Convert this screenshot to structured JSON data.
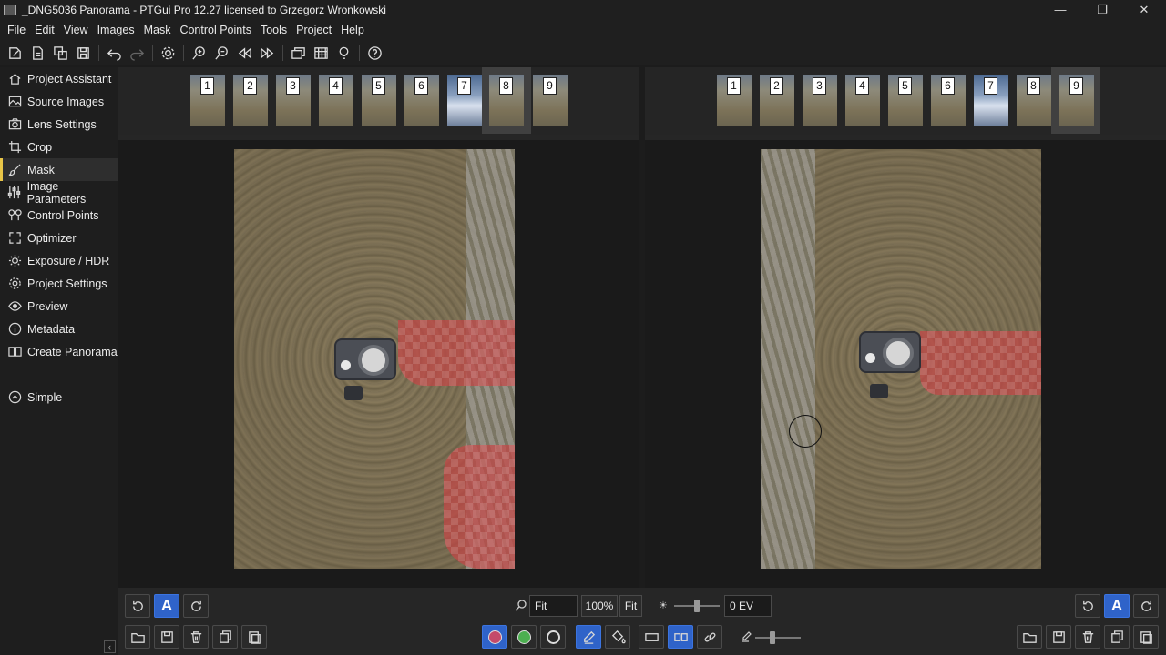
{
  "window": {
    "title": "_DNG5036 Panorama - PTGui Pro 12.27 licensed to Grzegorz Wronkowski",
    "minimize_glyph": "—",
    "maximize_glyph": "❐",
    "close_glyph": "✕"
  },
  "menu": [
    "File",
    "Edit",
    "View",
    "Images",
    "Mask",
    "Control Points",
    "Tools",
    "Project",
    "Help"
  ],
  "toolbar": {
    "icons": [
      "new-project-icon",
      "open-project-icon",
      "copy-icon",
      "save-icon",
      "undo-icon",
      "redo-icon",
      "settings-icon",
      "zoom-in-icon",
      "zoom-out-icon",
      "previous-icon",
      "next-icon",
      "panorama-editor-icon",
      "table-icon",
      "lightbulb-icon",
      "help-icon"
    ]
  },
  "sidebar": {
    "items": [
      {
        "label": "Project Assistant",
        "icon": "home-icon"
      },
      {
        "label": "Source Images",
        "icon": "image-icon"
      },
      {
        "label": "Lens Settings",
        "icon": "camera-icon"
      },
      {
        "label": "Crop",
        "icon": "crop-icon"
      },
      {
        "label": "Mask",
        "icon": "brush-icon",
        "active": true
      },
      {
        "label": "Image Parameters",
        "icon": "sliders-icon"
      },
      {
        "label": "Control Points",
        "icon": "control-points-icon"
      },
      {
        "label": "Optimizer",
        "icon": "optimizer-icon"
      },
      {
        "label": "Exposure / HDR",
        "icon": "sun-icon"
      },
      {
        "label": "Project Settings",
        "icon": "gear-icon"
      },
      {
        "label": "Preview",
        "icon": "eye-icon"
      },
      {
        "label": "Metadata",
        "icon": "info-icon"
      },
      {
        "label": "Create Panorama",
        "icon": "book-icon"
      }
    ],
    "simple_label": "Simple",
    "collapse_glyph": "‹"
  },
  "left_pane": {
    "thumbs": [
      "1",
      "2",
      "3",
      "4",
      "5",
      "6",
      "7",
      "8",
      "9"
    ],
    "selected": "8"
  },
  "right_pane": {
    "thumbs": [
      "1",
      "2",
      "3",
      "4",
      "5",
      "6",
      "7",
      "8",
      "9"
    ],
    "selected": "9"
  },
  "bottom": {
    "zoom_value": "Fit",
    "zoom_100": "100%",
    "zoom_fit": "Fit",
    "exposure_value": "0 EV",
    "auto_label": "A"
  },
  "colors": {
    "accent": "#e8c547",
    "button_blue": "#2f63c9",
    "mask_red": "#c44646",
    "mask_green": "#4caf50"
  }
}
